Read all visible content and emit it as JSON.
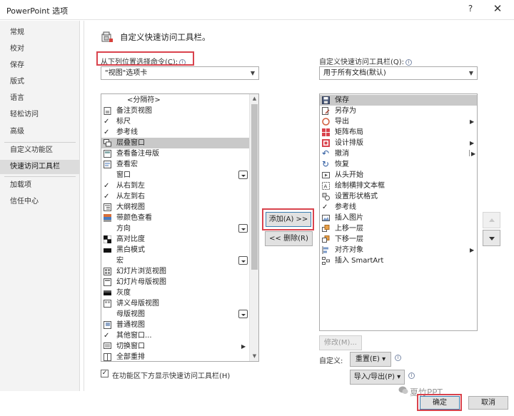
{
  "window": {
    "title": "PowerPoint 选项",
    "help": "?",
    "close": "✕"
  },
  "sidebar": {
    "items": [
      {
        "label": "常规"
      },
      {
        "label": "校对"
      },
      {
        "label": "保存"
      },
      {
        "label": "版式"
      },
      {
        "label": "语言"
      },
      {
        "label": "轻松访问"
      },
      {
        "label": "高级"
      },
      {
        "label": "自定义功能区"
      },
      {
        "label": "快速访问工具栏",
        "selected": true
      },
      {
        "label": "加载项"
      },
      {
        "label": "信任中心"
      }
    ]
  },
  "header": {
    "title": "自定义快速访问工具栏。"
  },
  "left": {
    "choose_label": "从下列位置选择命令(C):",
    "choose_value": "\"视图\"选项卡",
    "items": [
      {
        "label": "<分隔符>",
        "icon": "separator"
      },
      {
        "label": "备注页视图",
        "icon": "page-icon"
      },
      {
        "label": "标尺",
        "icon": "check-icon"
      },
      {
        "label": "参考线",
        "icon": "check-icon"
      },
      {
        "label": "层叠窗口",
        "icon": "cascade-icon",
        "selected": true
      },
      {
        "label": "查看备注母版",
        "icon": "notes-master-icon"
      },
      {
        "label": "查看宏",
        "icon": "macro-icon"
      },
      {
        "label": "窗口",
        "icon": "none",
        "button": true
      },
      {
        "label": "从右到左",
        "icon": "check-icon"
      },
      {
        "label": "从左到右",
        "icon": "check-icon"
      },
      {
        "label": "大纲视图",
        "icon": "outline-icon"
      },
      {
        "label": "带颜色查看",
        "icon": "color-icon"
      },
      {
        "label": "方向",
        "icon": "none",
        "button": true
      },
      {
        "label": "高对比度",
        "icon": "contrast-icon"
      },
      {
        "label": "黑白模式",
        "icon": "bw-icon"
      },
      {
        "label": "宏",
        "icon": "none",
        "button": true
      },
      {
        "label": "幻灯片浏览视图",
        "icon": "sorter-icon"
      },
      {
        "label": "幻灯片母版视图",
        "icon": "master-icon"
      },
      {
        "label": "灰度",
        "icon": "gray-icon"
      },
      {
        "label": "讲义母版视图",
        "icon": "handout-icon"
      },
      {
        "label": "母版视图",
        "icon": "none",
        "button": true
      },
      {
        "label": "普通视图",
        "icon": "normal-icon"
      },
      {
        "label": "其他窗口...",
        "icon": "check-icon"
      },
      {
        "label": "切换窗口",
        "icon": "switch-icon",
        "submenu": true
      },
      {
        "label": "全部重排",
        "icon": "arrange-icon"
      }
    ],
    "show_below_label": "在功能区下方显示快速访问工具栏(H)",
    "show_below_checked": "✓"
  },
  "middle": {
    "add_label": "添加(A) >>",
    "remove_label": "<< 删除(R)"
  },
  "right": {
    "customize_label": "自定义快速访问工具栏(Q):",
    "customize_value": "用于所有文档(默认)",
    "items": [
      {
        "label": "保存",
        "icon": "save-icon",
        "selected": true
      },
      {
        "label": "另存为",
        "icon": "saveas-icon"
      },
      {
        "label": "导出",
        "icon": "export-icon",
        "submenu": true
      },
      {
        "label": "矩阵布局",
        "icon": "matrix-icon"
      },
      {
        "label": "设计排版",
        "icon": "design-icon",
        "submenu": true
      },
      {
        "label": "撤消",
        "icon": "undo-icon",
        "submenu": true
      },
      {
        "label": "恢复",
        "icon": "redo-icon"
      },
      {
        "label": "从头开始",
        "icon": "start-icon"
      },
      {
        "label": "绘制横排文本框",
        "icon": "textbox-icon"
      },
      {
        "label": "设置形状格式",
        "icon": "shape-format-icon"
      },
      {
        "label": "参考线",
        "icon": "check-icon"
      },
      {
        "label": "插入图片",
        "icon": "picture-icon"
      },
      {
        "label": "上移一层",
        "icon": "bring-forward-icon"
      },
      {
        "label": "下移一层",
        "icon": "send-backward-icon"
      },
      {
        "label": "对齐对象",
        "icon": "align-icon",
        "submenu": true
      },
      {
        "label": "插入 SmartArt",
        "icon": "smartart-icon"
      }
    ],
    "modify_label": "修改(M)...",
    "customize_row_label": "自定义:",
    "reset_label": "重置(E) ▾",
    "import_export_label": "导入/导出(P) ▾"
  },
  "footer": {
    "ok_label": "确定",
    "cancel_label": "取消"
  },
  "watermark": {
    "text": "夏竹PPT"
  },
  "colors": {
    "highlight": "#d9434d",
    "selected": "#c9c9c9",
    "sidebar": "#f3f3f3"
  }
}
